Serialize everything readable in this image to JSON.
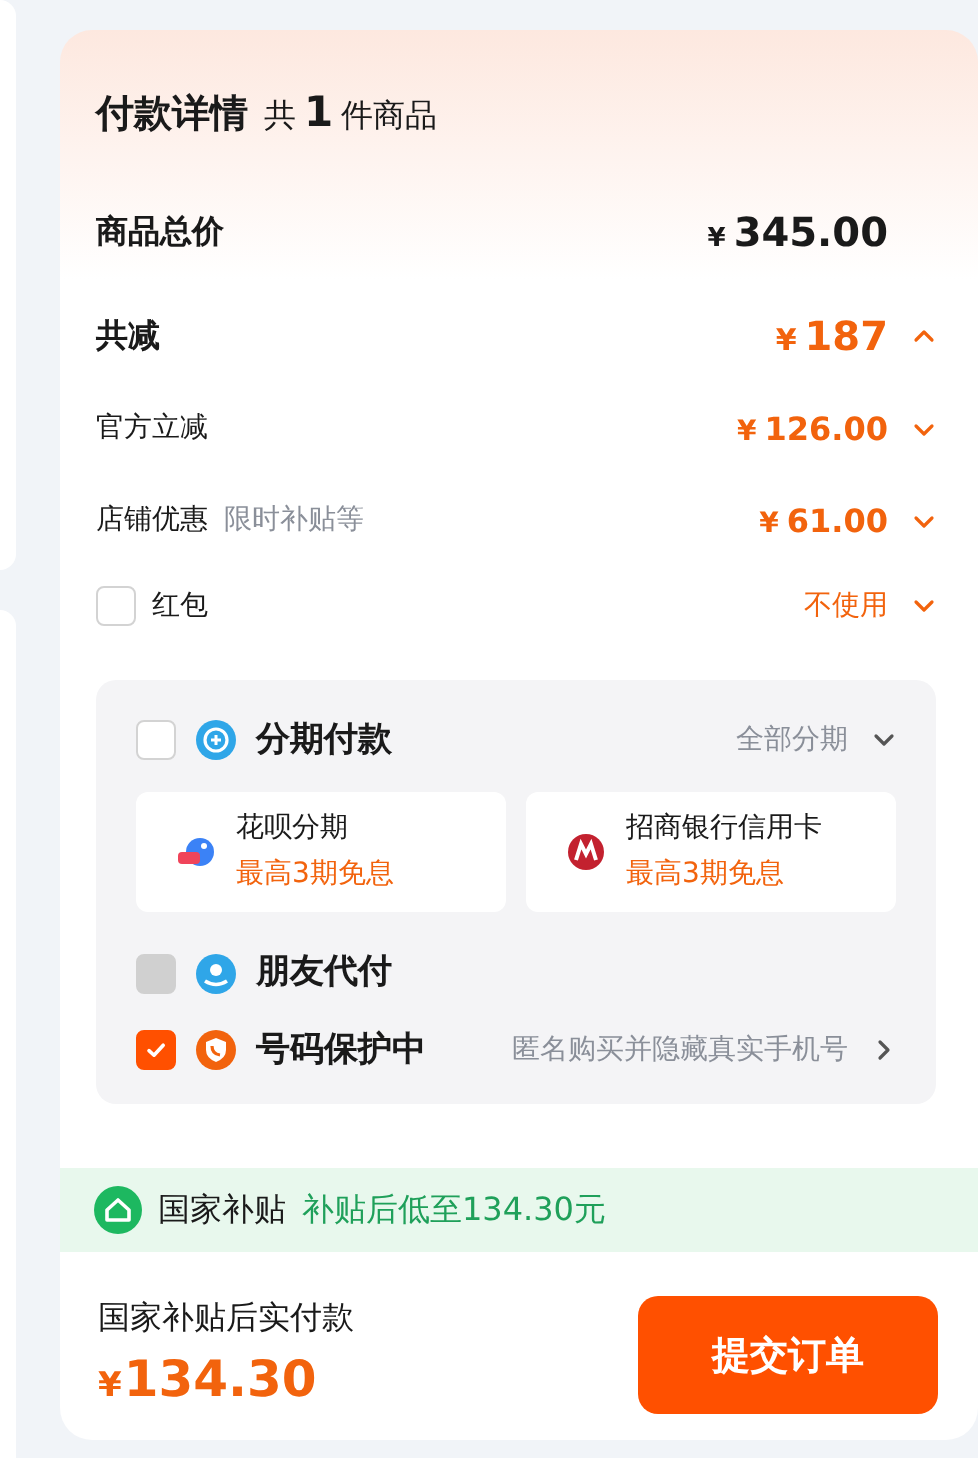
{
  "header": {
    "title": "付款详情",
    "count_prefix": "共",
    "count": "1",
    "count_suffix": "件商品"
  },
  "total": {
    "label": "商品总价",
    "currency": "¥",
    "amount": "345.00"
  },
  "discount": {
    "label": "共减",
    "currency": "¥",
    "amount": "187",
    "expanded": true
  },
  "discount_items": [
    {
      "label": "官方立减",
      "currency": "¥",
      "amount": "126.00",
      "expanded": false
    },
    {
      "label": "店铺优惠",
      "note": "限时补贴等",
      "currency": "¥",
      "amount": "61.00",
      "expanded": false
    }
  ],
  "red_packet": {
    "label": "红包",
    "checked": false,
    "value": "不使用",
    "expanded": false
  },
  "payment_options": [
    {
      "kind": "installment",
      "label": "分期付款",
      "checked": false,
      "disabled": false,
      "option": "全部分期",
      "plans": [
        {
          "kind": "huabei",
          "name": "花呗分期",
          "promo": "最高3期免息"
        },
        {
          "kind": "bank",
          "name": "招商银行信用卡",
          "promo": "最高3期免息"
        }
      ]
    },
    {
      "kind": "friend",
      "label": "朋友代付",
      "checked": false,
      "disabled": true
    },
    {
      "kind": "phone",
      "label": "号码保护中",
      "checked": true,
      "disabled": false,
      "note": "匿名购买并隐藏真实手机号"
    }
  ],
  "subsidy": {
    "label": "国家补贴",
    "text": "补贴后低至134.30元"
  },
  "footer": {
    "label": "国家补贴后实付款",
    "currency": "¥",
    "amount": "134.30",
    "button": "提交订单"
  }
}
